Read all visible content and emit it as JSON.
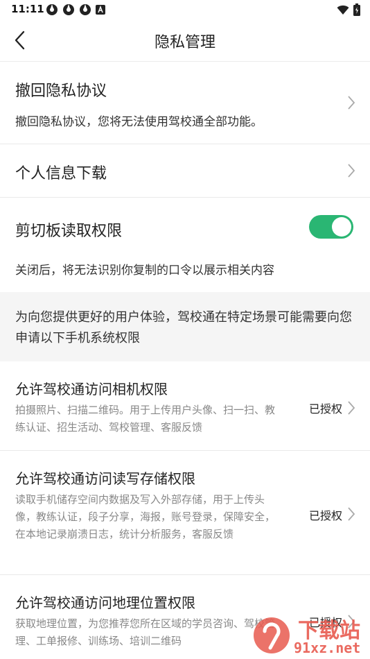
{
  "status_bar": {
    "time": "11:11"
  },
  "nav": {
    "title": "隐私管理"
  },
  "revoke": {
    "title": "撤回隐私协议",
    "desc": "撤回隐私协议，您将无法使用驾校通全部功能。"
  },
  "download": {
    "title": "个人信息下载"
  },
  "clipboard": {
    "title": "剪切板读取权限",
    "enabled": true,
    "desc": "关闭后，将无法识别你复制的口令以展示相关内容"
  },
  "info": {
    "text": "为向您提供更好的用户体验，驾校通在特定场景可能需要向您申请以下手机系统权限"
  },
  "permissions": [
    {
      "title": "允许驾校通访问相机权限",
      "desc": "拍摄照片、扫描二维码。用于上传用户头像、扫一扫、教练认证、招生活动、驾校管理、客服反馈",
      "status": "已授权"
    },
    {
      "title": "允许驾校通访问读写存储权限",
      "desc": "读取手机储存空间内数据及写入外部存储，用于上传头像，教练认证，段子分享，海报，账号登录，保障安全，在本地记录崩溃日志，统计分析服务，客服反馈",
      "status": "已授权"
    },
    {
      "title": "允许驾校通访问地理位置权限",
      "desc": "获取地理位置，为您推荐您所在区域的学员咨询、驾校管理、工单报修、训练场、培训二维码",
      "status": "已授权"
    }
  ],
  "watermark": {
    "text_cn": "下载站",
    "text_url": "91xz.net"
  },
  "colors": {
    "accent": "#2ab673",
    "divider": "#e9e9e9",
    "info_bg": "#f5f5f5"
  }
}
